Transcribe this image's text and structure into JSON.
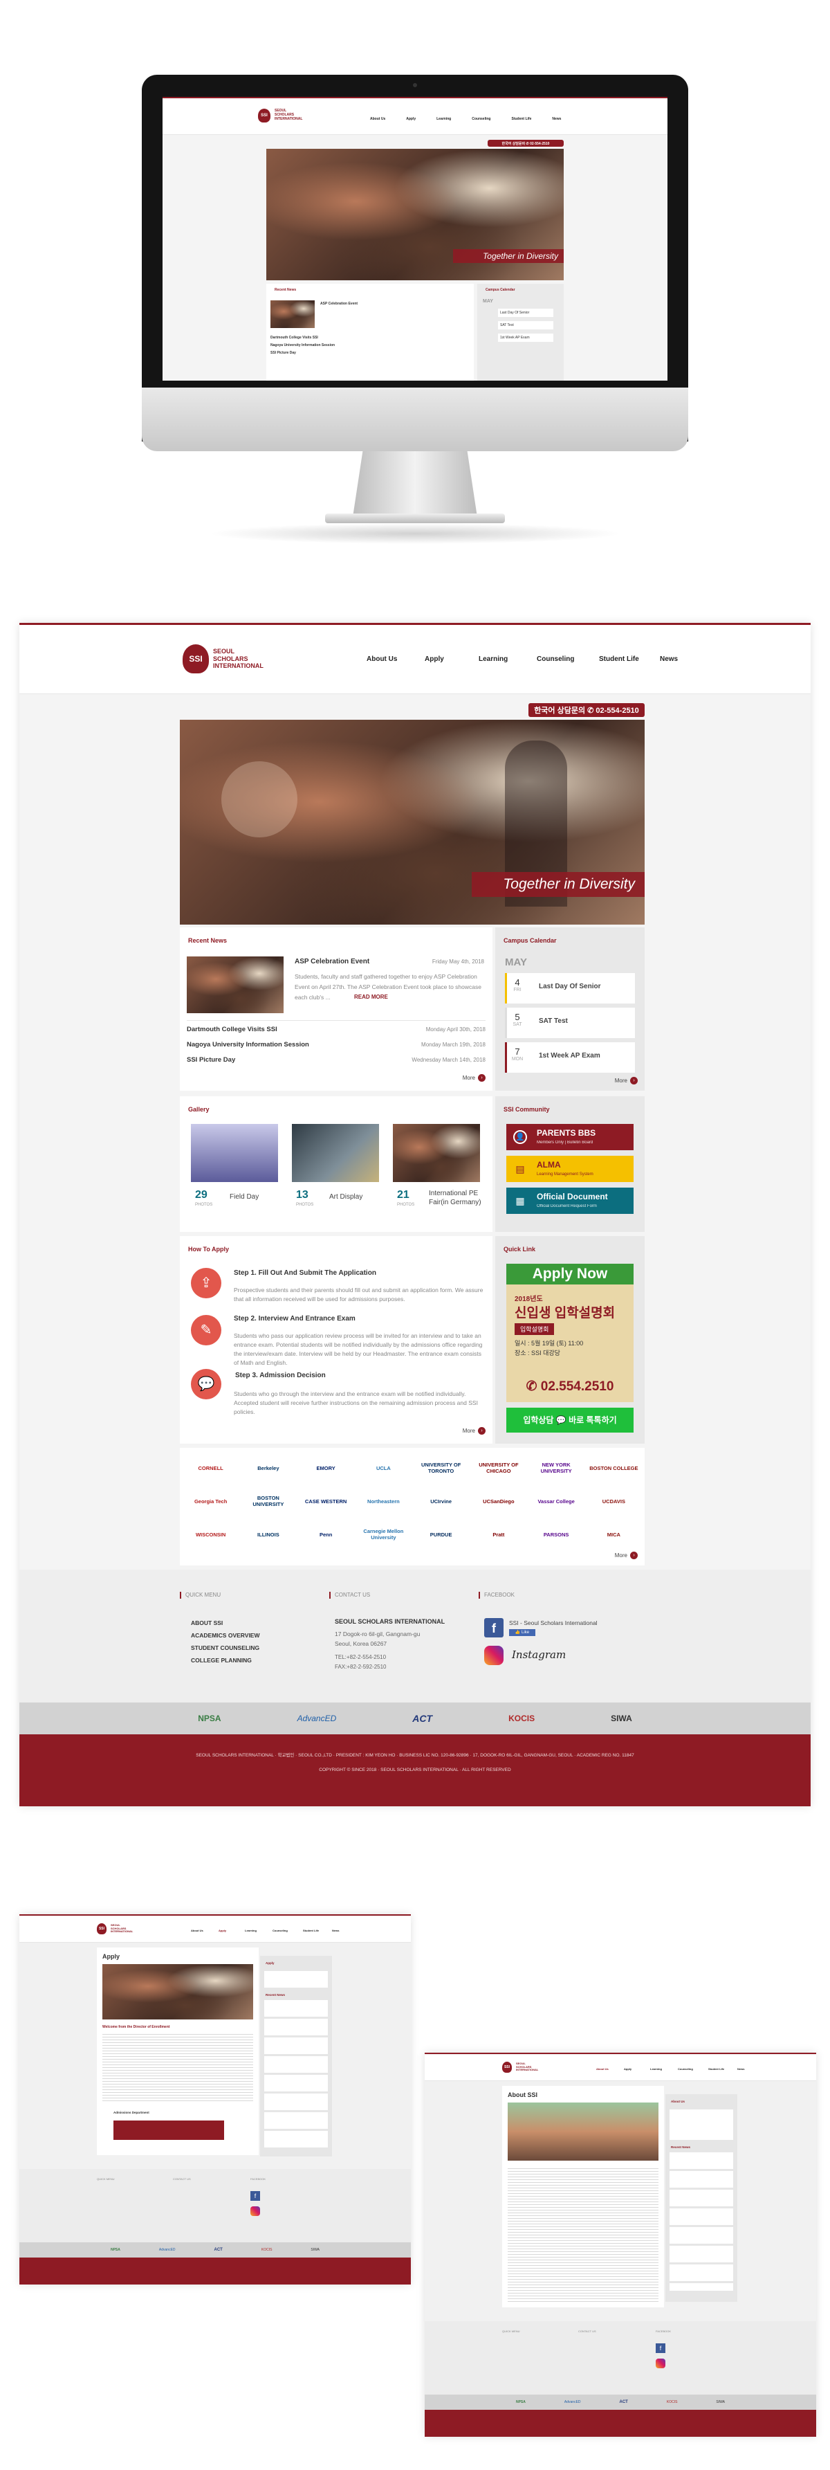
{
  "site": {
    "logo_text": "SEOUL SCHOLARS INTERNATIONAL",
    "logo_short": "SSI",
    "nav": [
      "About Us",
      "Apply",
      "Learning",
      "Counseling",
      "Student Life",
      "News"
    ],
    "hotline": "한국어 상담문의  ✆  02-554-2510",
    "hero_caption": "Together in Diversity"
  },
  "recent_news": {
    "title": "Recent News",
    "featured": {
      "headline": "ASP Celebration Event",
      "date": "Friday May 4th, 2018",
      "summary": "Students, faculty and staff gathered together to enjoy ASP Celebration Event on April 27th. The ASP Celebration Event took place to showcase each club's ...",
      "read_more": "READ MORE"
    },
    "items": [
      {
        "title": "Dartmouth College Visits SSI",
        "date": "Monday April 30th, 2018"
      },
      {
        "title": "Nagoya University Information Session",
        "date": "Monday March 19th, 2018"
      },
      {
        "title": "SSI Picture Day",
        "date": "Wednesday March 14th, 2018"
      }
    ],
    "more": "More"
  },
  "calendar": {
    "title": "Campus Calendar",
    "month": "MAY",
    "events": [
      {
        "day": "4",
        "dow": "FRI",
        "title": "Last Day Of Senior"
      },
      {
        "day": "5",
        "dow": "SAT",
        "title": "SAT Test"
      },
      {
        "day": "7",
        "dow": "MON",
        "title": "1st Week AP Exam"
      }
    ],
    "more": "More"
  },
  "gallery": {
    "title": "Gallery",
    "items": [
      {
        "count": "29",
        "unit": "PHOTOS",
        "title": "Field Day"
      },
      {
        "count": "13",
        "unit": "PHOTOS",
        "title": "Art Display"
      },
      {
        "count": "21",
        "unit": "PHOTOS",
        "title": "International PE Fair(in Germany)"
      }
    ]
  },
  "community": {
    "title": "SSI Community",
    "cards": [
      {
        "title": "PARENTS BBS",
        "sub": "Members Only | Bulletin Board",
        "color": "#8e1b24",
        "text_color": "#ffffff"
      },
      {
        "title": "ALMA",
        "sub": "Learning Management System",
        "color": "#f5c000",
        "text_color": "#8e1b24"
      },
      {
        "title": "Official Document",
        "sub": "Official Document Request Form",
        "color": "#0c6e7f",
        "text_color": "#ffffff"
      }
    ]
  },
  "how_to_apply": {
    "title": "How To Apply",
    "steps": [
      {
        "title": "Step 1. Fill Out And Submit The Application",
        "desc": "Prospective students and their parents should fill out and submit an application form. We assure that all information received will be used for admissions purposes."
      },
      {
        "title": "Step 2. Interview And Entrance Exam",
        "desc": "Students who pass our application review process will be invited for an interview and to take an entrance exam. Potential students will be notified individually by the admissions office regarding the interview/exam date. Interview will be held by our Headmaster. The entrance exam consists of Math and English."
      },
      {
        "title": "Step 3. Admission Decision",
        "desc": "Students who go through the interview and the entrance exam will be notified individually. Accepted student will receive further instructions on the remaining admission process and SSI policies."
      }
    ],
    "more": "More"
  },
  "quick_link": {
    "title": "Quick Link",
    "apply_now": "Apply Now",
    "year_line": "2018년도",
    "event_title": "신입생 입학설명회",
    "event_badge": "입학설명회",
    "event_time": "일시 : 5월 19일 (토) 11:00",
    "event_place": "장소 : SSI 대강당",
    "phone": "✆ 02.554.2510",
    "kakao": "입학상담  💬  바로 톡톡하기"
  },
  "universities": [
    "CORNELL",
    "Berkeley",
    "EMORY",
    "UCLA",
    "UNIVERSITY OF TORONTO",
    "UNIVERSITY OF CHICAGO",
    "NEW YORK UNIVERSITY",
    "BOSTON COLLEGE",
    "Georgia Tech",
    "BOSTON UNIVERSITY",
    "CASE WESTERN",
    "Northeastern",
    "UCIrvine",
    "UCSanDiego",
    "Vassar College",
    "UCDAVIS",
    "WISCONSIN",
    "ILLINOIS",
    "Penn",
    "Carnegie Mellon University",
    "PURDUE",
    "Pratt",
    "PARSONS",
    "MICA"
  ],
  "footer": {
    "quick_menu_title": "QUICK MENU",
    "quick_menu": [
      "ABOUT SSI",
      "ACADEMICS OVERVIEW",
      "STUDENT COUNSELING",
      "COLLEGE PLANNING"
    ],
    "contact_title": "CONTACT US",
    "contact_name": "SEOUL SCHOLARS INTERNATIONAL",
    "contact_address1": "17 Dogok-ro 6il-gil, Gangnam-gu",
    "contact_address2": "Seoul, Korea 06267",
    "contact_tel": "TEL:+82-2-554-2510",
    "contact_fax": "FAX:+82-2-592-2510",
    "facebook_title": "FACEBOOK",
    "facebook_page": "SSI - Seoul Scholars International",
    "instagram": "Instagram",
    "partners": [
      "NPSA",
      "AdvancED",
      "ACT",
      "KOCIS",
      "SIWA"
    ],
    "bottom1": "SEOUL SCHOLARS INTERNATIONAL · 학교법인 · SEOUL CO.,LTD · PRESIDENT : KIM YEON HO · BUSINESS LIC NO. 120-86-92896 · 17, DOGOK-RO 6IL-GIL, GANGNAM-GU, SEOUL · ACADEMIC REG NO. 11847",
    "bottom2": "COPYRIGHT © SINCE 2018 · SEOUL SCHOLARS INTERNATIONAL · ALL RIGHT RESERVED"
  },
  "apply_page": {
    "title": "Apply",
    "welcome": "Welcome from the Director of Enrollment",
    "sidebar_title": "Apply",
    "signature_title": "Admissions Department"
  },
  "about_page": {
    "title": "About SSI"
  },
  "colors": {
    "brand": "#8e1b24",
    "footer_gray": "#eeeeee",
    "partner_gray": "#d2d2d2"
  }
}
